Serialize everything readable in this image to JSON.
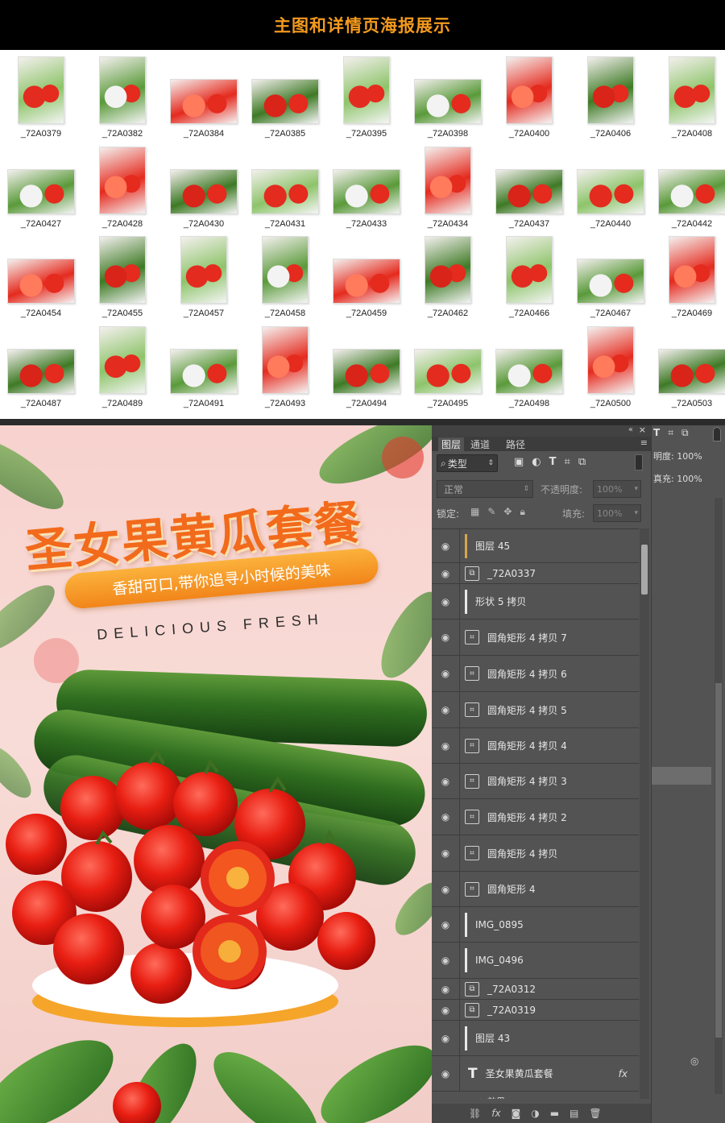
{
  "banner": {
    "title": "主图和详情页海报展示"
  },
  "gallery": {
    "rows": [
      [
        "_72A0379",
        "_72A0382",
        "_72A0384",
        "_72A0385",
        "_72A0395",
        "_72A0398",
        "_72A0400",
        "_72A0406",
        "_72A0408"
      ],
      [
        "_72A0427",
        "_72A0428",
        "_72A0430",
        "_72A0431",
        "_72A0433",
        "_72A0434",
        "_72A0437",
        "_72A0440",
        "_72A0442"
      ],
      [
        "_72A0454",
        "_72A0455",
        "_72A0457",
        "_72A0458",
        "_72A0459",
        "_72A0462",
        "_72A0466",
        "_72A0467",
        "_72A0469"
      ],
      [
        "_72A0487",
        "_72A0489",
        "_72A0491",
        "_72A0493",
        "_72A0494",
        "_72A0495",
        "_72A0498",
        "_72A0500",
        "_72A0503"
      ]
    ]
  },
  "poster": {
    "title": "圣女果黄瓜套餐",
    "slogan": "香甜可口,带你追寻小时候的美味",
    "subtitle": "DELICIOUS FRESH"
  },
  "ps": {
    "tabs": [
      "图层",
      "通道",
      "路径"
    ],
    "filter_label": "类型",
    "blend_mode": "正常",
    "opacity_label": "不透明度:",
    "opacity_value": "100%",
    "lock_label": "锁定:",
    "fill_label": "填充:",
    "fill_value": "100%",
    "side_opacity": "明度: 100%",
    "side_fill": "真充: 100%",
    "layers": [
      {
        "name": "图层 45",
        "icon": "bar"
      },
      {
        "name": "_72A0337",
        "icon": "smart"
      },
      {
        "name": "形状 5 拷贝",
        "icon": "bar"
      },
      {
        "name": "圆角矩形 4 拷贝 7",
        "icon": "shape"
      },
      {
        "name": "圆角矩形 4 拷贝 6",
        "icon": "shape"
      },
      {
        "name": "圆角矩形 4 拷贝 5",
        "icon": "shape"
      },
      {
        "name": "圆角矩形 4 拷贝 4",
        "icon": "shape"
      },
      {
        "name": "圆角矩形 4 拷贝 3",
        "icon": "shape"
      },
      {
        "name": "圆角矩形 4 拷贝 2",
        "icon": "shape"
      },
      {
        "name": "圆角矩形 4 拷贝",
        "icon": "shape"
      },
      {
        "name": "圆角矩形 4",
        "icon": "shape"
      },
      {
        "name": "IMG_0895",
        "icon": "bar"
      },
      {
        "name": "IMG_0496",
        "icon": "bar"
      },
      {
        "name": "_72A0312",
        "icon": "smart"
      },
      {
        "name": "_72A0319",
        "icon": "smart"
      },
      {
        "name": "图层 43",
        "icon": "bar"
      },
      {
        "name": "圣女果黄瓜套餐",
        "icon": "text"
      }
    ],
    "effects_label": "效果",
    "fx_label": "fx"
  }
}
